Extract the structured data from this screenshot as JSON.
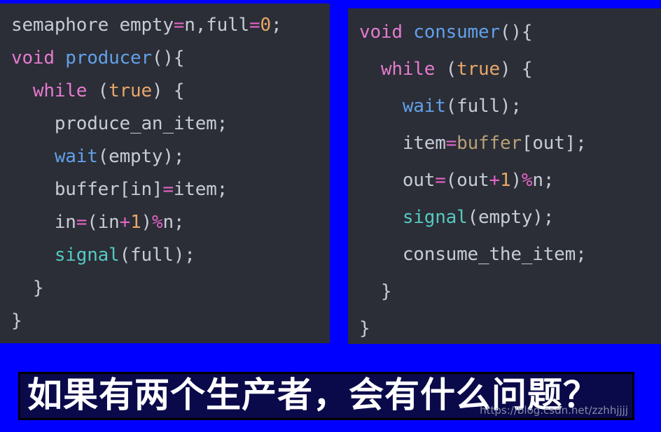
{
  "theme": {
    "page_background": "#0000ff",
    "code_background": "#2b2e36",
    "banner_background": "#0a0a4a",
    "banner_border": "#000000",
    "banner_text_color": "#ffffff",
    "token_plain": "#c6ccd6",
    "token_keyword": "#e57ad0",
    "token_function": "#62a0ea",
    "token_call": "#55c9c2",
    "token_number": "#e8a76a",
    "token_operator": "#e464c8",
    "token_variable": "#b9a07a"
  },
  "left_panel": {
    "name": "producer-code",
    "lines": [
      {
        "indent": 0,
        "tokens": [
          {
            "text": "semaphore ",
            "type": "plain"
          },
          {
            "text": "empty",
            "type": "plain"
          },
          {
            "text": "=",
            "type": "op"
          },
          {
            "text": "n,full",
            "type": "plain"
          },
          {
            "text": "=",
            "type": "op"
          },
          {
            "text": "0",
            "type": "num"
          },
          {
            "text": ";",
            "type": "plain"
          }
        ]
      },
      {
        "indent": 0,
        "tokens": [
          {
            "text": "void ",
            "type": "kw"
          },
          {
            "text": "producer",
            "type": "fn"
          },
          {
            "text": "(){",
            "type": "plain"
          }
        ]
      },
      {
        "indent": 1,
        "tokens": [
          {
            "text": "while ",
            "type": "kw"
          },
          {
            "text": "(",
            "type": "plain"
          },
          {
            "text": "true",
            "type": "num"
          },
          {
            "text": ") {",
            "type": "plain"
          }
        ]
      },
      {
        "indent": 2,
        "tokens": [
          {
            "text": "produce_an_item;",
            "type": "plain"
          }
        ]
      },
      {
        "indent": 2,
        "tokens": [
          {
            "text": "wait",
            "type": "fn"
          },
          {
            "text": "(empty);",
            "type": "plain"
          }
        ]
      },
      {
        "indent": 2,
        "tokens": [
          {
            "text": "buffer[in]",
            "type": "plain"
          },
          {
            "text": "=",
            "type": "op"
          },
          {
            "text": "item;",
            "type": "plain"
          }
        ]
      },
      {
        "indent": 2,
        "tokens": [
          {
            "text": "in",
            "type": "plain"
          },
          {
            "text": "=",
            "type": "op"
          },
          {
            "text": "(in",
            "type": "plain"
          },
          {
            "text": "+",
            "type": "op"
          },
          {
            "text": "1",
            "type": "num"
          },
          {
            "text": ")",
            "type": "plain"
          },
          {
            "text": "%",
            "type": "op"
          },
          {
            "text": "n;",
            "type": "plain"
          }
        ]
      },
      {
        "indent": 2,
        "tokens": [
          {
            "text": "signal",
            "type": "call"
          },
          {
            "text": "(full);",
            "type": "plain"
          }
        ]
      },
      {
        "indent": 1,
        "tokens": [
          {
            "text": "}",
            "type": "plain"
          }
        ]
      },
      {
        "indent": 0,
        "tokens": [
          {
            "text": "}",
            "type": "plain"
          }
        ]
      }
    ]
  },
  "right_panel": {
    "name": "consumer-code",
    "lines": [
      {
        "indent": 0,
        "tokens": [
          {
            "text": "void ",
            "type": "kw"
          },
          {
            "text": "consumer",
            "type": "fn"
          },
          {
            "text": "(){",
            "type": "plain"
          }
        ]
      },
      {
        "indent": 1,
        "tokens": [
          {
            "text": "while ",
            "type": "kw"
          },
          {
            "text": "(",
            "type": "plain"
          },
          {
            "text": "true",
            "type": "num"
          },
          {
            "text": ") {",
            "type": "plain"
          }
        ]
      },
      {
        "indent": 2,
        "tokens": [
          {
            "text": "wait",
            "type": "fn"
          },
          {
            "text": "(full);",
            "type": "plain"
          }
        ]
      },
      {
        "indent": 2,
        "tokens": [
          {
            "text": "item",
            "type": "plain"
          },
          {
            "text": "=",
            "type": "op"
          },
          {
            "text": "buffer",
            "type": "var"
          },
          {
            "text": "[out];",
            "type": "plain"
          }
        ]
      },
      {
        "indent": 2,
        "tokens": [
          {
            "text": "out",
            "type": "plain"
          },
          {
            "text": "=",
            "type": "op"
          },
          {
            "text": "(out",
            "type": "plain"
          },
          {
            "text": "+",
            "type": "op"
          },
          {
            "text": "1",
            "type": "num"
          },
          {
            "text": ")",
            "type": "plain"
          },
          {
            "text": "%",
            "type": "op"
          },
          {
            "text": "n;",
            "type": "plain"
          }
        ]
      },
      {
        "indent": 2,
        "tokens": [
          {
            "text": "signal",
            "type": "call"
          },
          {
            "text": "(empty);",
            "type": "plain"
          }
        ]
      },
      {
        "indent": 2,
        "tokens": [
          {
            "text": "consume_the_item;",
            "type": "plain"
          }
        ]
      },
      {
        "indent": 1,
        "tokens": [
          {
            "text": "}",
            "type": "plain"
          }
        ]
      },
      {
        "indent": 0,
        "tokens": [
          {
            "text": "}",
            "type": "plain"
          }
        ]
      }
    ]
  },
  "banner": {
    "question": "如果有两个生产者，会有什么问题？",
    "watermark": "https://blog.csdn.net/zzhhjjjj"
  }
}
